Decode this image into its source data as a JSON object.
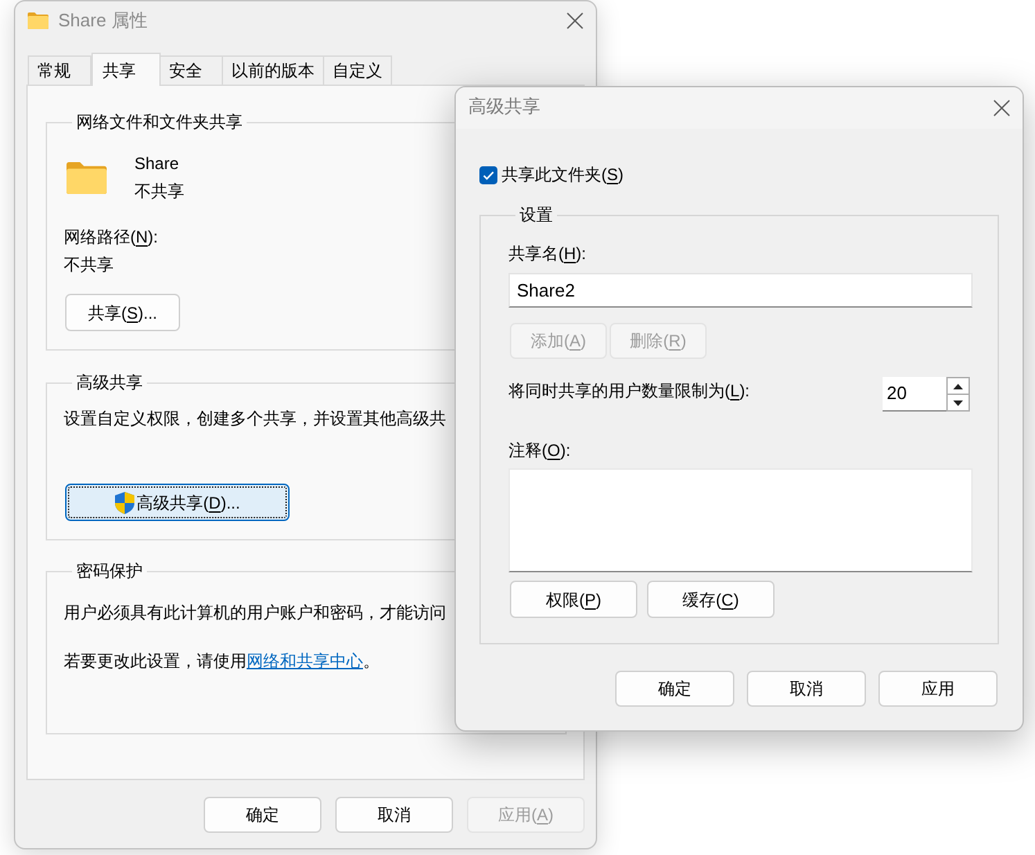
{
  "properties_window": {
    "title": "Share 属性",
    "tabs": [
      {
        "label": "常规",
        "selected": false
      },
      {
        "label": "共享",
        "selected": true
      },
      {
        "label": "安全",
        "selected": false
      },
      {
        "label": "以前的版本",
        "selected": false
      },
      {
        "label": "自定义",
        "selected": false
      }
    ],
    "network_sharing": {
      "title": "网络文件和文件夹共享",
      "folder_name": "Share",
      "folder_status": "不共享",
      "path_label": "网络路径(N):",
      "path_value": "不共享",
      "share_button": "共享(S)..."
    },
    "advanced_sharing": {
      "title": "高级共享",
      "description": "设置自定义权限，创建多个共享，并设置其他高级共",
      "button": {
        "label": "高级共享(D)...",
        "focused": true
      }
    },
    "password_protection": {
      "title": "密码保护",
      "description": "用户必须具有此计算机的用户账户和密码，才能访问",
      "change_setting": {
        "text": "若要更改此设置，请使用",
        "link": "网络和共享中心",
        "end": "。"
      }
    },
    "buttons": [
      {
        "label": "确定",
        "disabled": false
      },
      {
        "label": "取消",
        "disabled": false
      },
      {
        "label": "应用(A)",
        "disabled": true
      }
    ]
  },
  "advanced_sharing_dialog": {
    "title": "高级共享",
    "share_checkbox": {
      "label": "共享此文件夹(S)",
      "checked": true
    },
    "settings": {
      "title": "设置",
      "share_name_label": "共享名(H):",
      "share_name_value": "Share2",
      "share_name_buttons": [
        {
          "label": "添加(A)",
          "disabled": true
        },
        {
          "label": "删除(R)",
          "disabled": true
        }
      ],
      "user_limit_label": "将同时共享的用户数量限制为(L):",
      "user_limit_value": "20",
      "comment_label": "注释(O):",
      "buttons": [
        "权限(P)",
        "缓存(C)"
      ]
    },
    "buttons": [
      {
        "label": "确定",
        "disabled": false
      },
      {
        "label": "取消",
        "disabled": false
      },
      {
        "label": "应用",
        "disabled": false
      }
    ]
  }
}
